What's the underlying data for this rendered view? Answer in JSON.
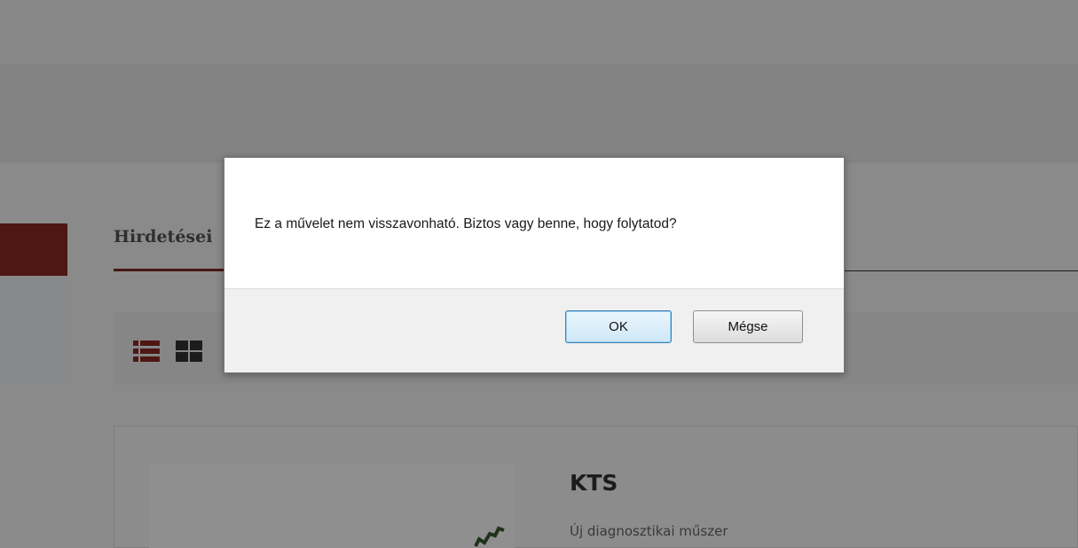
{
  "background_page": {
    "section_title": "Hirdetései",
    "card": {
      "title": "KTS",
      "subtitle": "Új diagnosztikai műszer"
    },
    "view_icons": [
      "list-view-icon",
      "grid-view-icon"
    ]
  },
  "dialog": {
    "message": "Ez a művelet nem visszavonható. Biztos vagy benne, hogy folytatod?",
    "ok_label": "OK",
    "cancel_label": "Mégse"
  },
  "colors": {
    "accent": "#8b2a24",
    "overlay": "rgba(0,0,0,0.44)",
    "dialog_footer": "#f0f0f0"
  }
}
